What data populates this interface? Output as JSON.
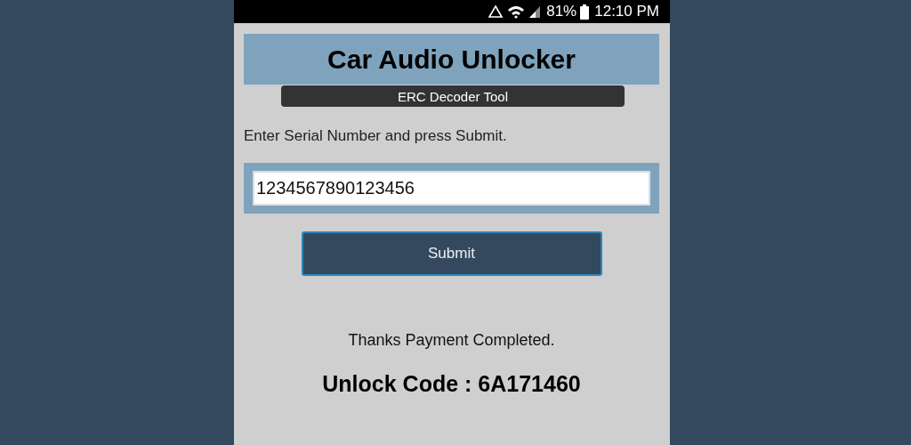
{
  "status_bar": {
    "battery": "81%",
    "time": "12:10 PM"
  },
  "header": {
    "title": "Car Audio Unlocker",
    "subtitle": "ERC Decoder Tool"
  },
  "instruction": "Enter Serial Number and press Submit.",
  "serial_field": {
    "value": "1234567890123456"
  },
  "submit_button": {
    "label": "Submit"
  },
  "result": {
    "message": "Thanks Payment Completed.",
    "code": "Unlock Code : 6A171460"
  }
}
